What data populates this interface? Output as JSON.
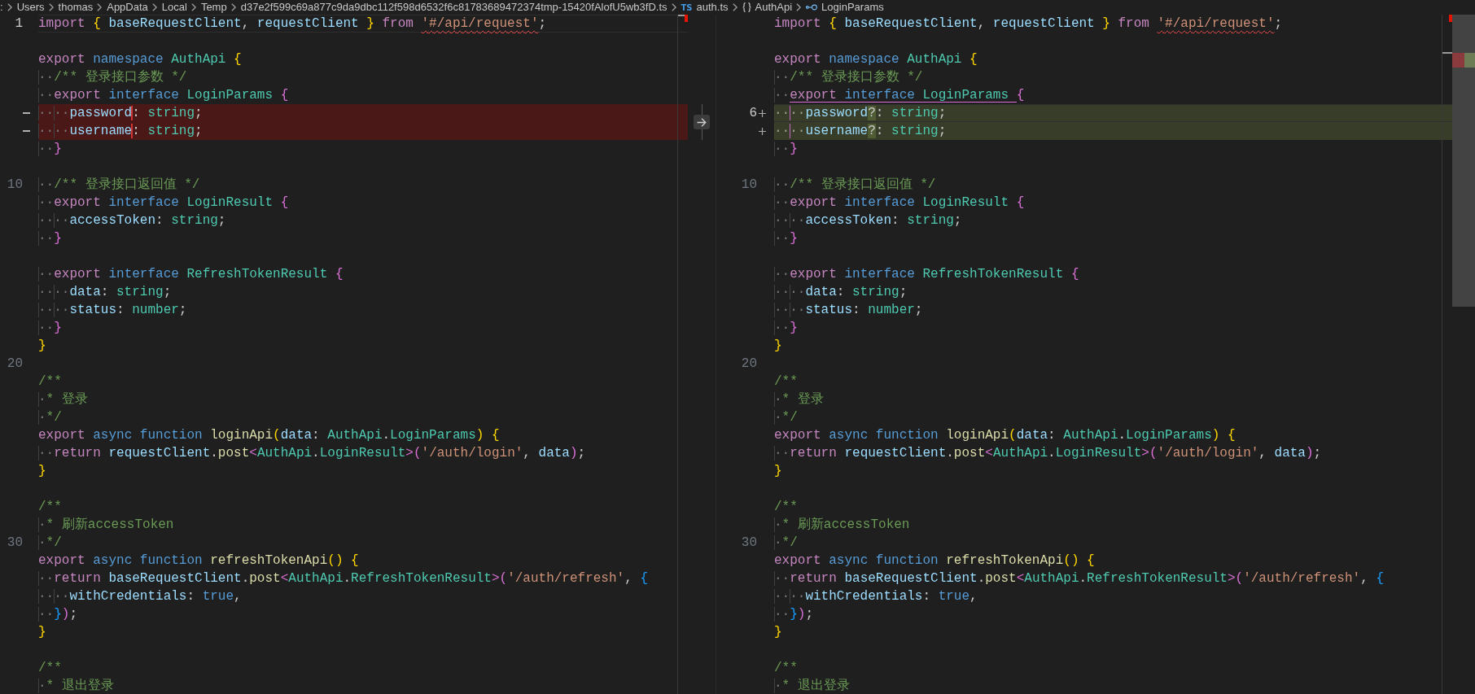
{
  "breadcrumbs": [
    {
      "label": ":",
      "kind": "folder"
    },
    {
      "label": "Users",
      "kind": "folder"
    },
    {
      "label": "thomas",
      "kind": "folder"
    },
    {
      "label": "AppData",
      "kind": "folder"
    },
    {
      "label": "Local",
      "kind": "folder"
    },
    {
      "label": "Temp",
      "kind": "folder"
    },
    {
      "label": "d37e2f599c69a877c9da9dbc112f598d6532f6c81783689472374tmp-15420fAlofU5wb3fD.ts",
      "kind": "folder"
    },
    {
      "label": "auth.ts",
      "kind": "file",
      "badge": "TS"
    },
    {
      "label": "AuthApi",
      "kind": "namespace"
    },
    {
      "label": "LoginParams",
      "kind": "interface"
    }
  ],
  "panes": [
    {
      "lines": [
        {
          "kind": "current",
          "number": "1",
          "tokens": [
            {
              "text": "import ",
              "kind": "keyword"
            },
            {
              "text": "{ ",
              "kind": "bracket1"
            },
            {
              "text": "baseRequestClient",
              "kind": "variable"
            },
            {
              "text": ", ",
              "kind": "plain"
            },
            {
              "text": "requestClient ",
              "kind": "variable"
            },
            {
              "text": "} ",
              "kind": "bracket1"
            },
            {
              "text": "from ",
              "kind": "keyword"
            },
            {
              "text": "'#/api/request'",
              "kind": "squiggle"
            },
            {
              "text": ";",
              "kind": "plain"
            }
          ]
        },
        {
          "kind": "context"
        },
        {
          "kind": "context",
          "tokens": [
            {
              "text": "export ",
              "kind": "keyword"
            },
            {
              "text": "namespace ",
              "kind": "storage"
            },
            {
              "text": "AuthApi ",
              "kind": "type"
            },
            {
              "text": "{",
              "kind": "bracket1"
            }
          ]
        },
        {
          "kind": "context",
          "tokens": [
            {
              "text": "··",
              "kind": "space"
            },
            {
              "text": "/** 登录接口参数 */",
              "kind": "comment"
            }
          ]
        },
        {
          "kind": "context",
          "tokens": [
            {
              "text": "··",
              "kind": "space"
            },
            {
              "text": "export ",
              "kind": "keyword"
            },
            {
              "text": "interface ",
              "kind": "storage"
            },
            {
              "text": "LoginParams ",
              "kind": "type"
            },
            {
              "text": "{",
              "kind": "bracket2"
            }
          ]
        },
        {
          "kind": "removed",
          "tokens": [
            {
              "text": "····",
              "kind": "space"
            },
            {
              "text": "password",
              "kind": "variable"
            },
            {
              "text": ": ",
              "kind": "cut"
            },
            {
              "text": "string",
              "kind": "type"
            },
            {
              "text": ";",
              "kind": "plain"
            }
          ]
        },
        {
          "kind": "removed",
          "tokens": [
            {
              "text": "····",
              "kind": "space"
            },
            {
              "text": "username",
              "kind": "variable"
            },
            {
              "text": ": ",
              "kind": "cut"
            },
            {
              "text": "string",
              "kind": "type"
            },
            {
              "text": ";",
              "kind": "plain"
            }
          ]
        },
        {
          "kind": "context",
          "tokens": [
            {
              "text": "··",
              "kind": "space"
            },
            {
              "text": "}",
              "kind": "bracket2"
            }
          ]
        },
        {
          "kind": "context"
        },
        {
          "kind": "context",
          "number": "10",
          "tokens": [
            {
              "text": "··",
              "kind": "space"
            },
            {
              "text": "/** 登录接口返回值 */",
              "kind": "comment"
            }
          ]
        },
        {
          "kind": "context",
          "tokens": [
            {
              "text": "··",
              "kind": "space"
            },
            {
              "text": "export ",
              "kind": "keyword"
            },
            {
              "text": "interface ",
              "kind": "storage"
            },
            {
              "text": "LoginResult ",
              "kind": "type"
            },
            {
              "text": "{",
              "kind": "bracket2"
            }
          ]
        },
        {
          "kind": "context",
          "tokens": [
            {
              "text": "····",
              "kind": "space"
            },
            {
              "text": "accessToken",
              "kind": "variable"
            },
            {
              "text": ": ",
              "kind": "plain"
            },
            {
              "text": "string",
              "kind": "type"
            },
            {
              "text": ";",
              "kind": "plain"
            }
          ]
        },
        {
          "kind": "context",
          "tokens": [
            {
              "text": "··",
              "kind": "space"
            },
            {
              "text": "}",
              "kind": "bracket2"
            }
          ]
        },
        {
          "kind": "context"
        },
        {
          "kind": "context",
          "tokens": [
            {
              "text": "··",
              "kind": "space"
            },
            {
              "text": "export ",
              "kind": "keyword"
            },
            {
              "text": "interface ",
              "kind": "storage"
            },
            {
              "text": "RefreshTokenResult ",
              "kind": "type"
            },
            {
              "text": "{",
              "kind": "bracket2"
            }
          ]
        },
        {
          "kind": "context",
          "tokens": [
            {
              "text": "····",
              "kind": "space"
            },
            {
              "text": "data",
              "kind": "variable"
            },
            {
              "text": ": ",
              "kind": "plain"
            },
            {
              "text": "string",
              "kind": "type"
            },
            {
              "text": ";",
              "kind": "plain"
            }
          ]
        },
        {
          "kind": "context",
          "tokens": [
            {
              "text": "····",
              "kind": "space"
            },
            {
              "text": "status",
              "kind": "variable"
            },
            {
              "text": ": ",
              "kind": "plain"
            },
            {
              "text": "number",
              "kind": "type"
            },
            {
              "text": ";",
              "kind": "plain"
            }
          ]
        },
        {
          "kind": "context",
          "tokens": [
            {
              "text": "··",
              "kind": "space"
            },
            {
              "text": "}",
              "kind": "bracket2"
            }
          ]
        },
        {
          "kind": "context",
          "tokens": [
            {
              "text": "}",
              "kind": "bracket1"
            }
          ]
        },
        {
          "kind": "context",
          "number": "20"
        },
        {
          "kind": "context",
          "tokens": [
            {
              "text": "/**",
              "kind": "comment"
            }
          ]
        },
        {
          "kind": "context",
          "tokens": [
            {
              "text": "·",
              "kind": "space"
            },
            {
              "text": "* 登录",
              "kind": "comment"
            }
          ]
        },
        {
          "kind": "context",
          "tokens": [
            {
              "text": "·",
              "kind": "space"
            },
            {
              "text": "*/",
              "kind": "comment"
            }
          ]
        },
        {
          "kind": "context",
          "tokens": [
            {
              "text": "export ",
              "kind": "keyword"
            },
            {
              "text": "async ",
              "kind": "storage"
            },
            {
              "text": "function ",
              "kind": "storage"
            },
            {
              "text": "loginApi",
              "kind": "function"
            },
            {
              "text": "(",
              "kind": "bracket1"
            },
            {
              "text": "data",
              "kind": "variable"
            },
            {
              "text": ": ",
              "kind": "plain"
            },
            {
              "text": "AuthApi",
              "kind": "type"
            },
            {
              "text": ".",
              "kind": "plain"
            },
            {
              "text": "LoginParams",
              "kind": "type"
            },
            {
              "text": ") {",
              "kind": "bracket1"
            }
          ]
        },
        {
          "kind": "context",
          "tokens": [
            {
              "text": "··",
              "kind": "space"
            },
            {
              "text": "return ",
              "kind": "keyword"
            },
            {
              "text": "requestClient",
              "kind": "variable"
            },
            {
              "text": ".",
              "kind": "plain"
            },
            {
              "text": "post",
              "kind": "function"
            },
            {
              "text": "<",
              "kind": "bracket2"
            },
            {
              "text": "AuthApi",
              "kind": "type"
            },
            {
              "text": ".",
              "kind": "plain"
            },
            {
              "text": "LoginResult",
              "kind": "type"
            },
            {
              "text": ">(",
              "kind": "bracket2"
            },
            {
              "text": "'/auth/login'",
              "kind": "string"
            },
            {
              "text": ", ",
              "kind": "plain"
            },
            {
              "text": "data",
              "kind": "variable"
            },
            {
              "text": ")",
              "kind": "bracket2"
            },
            {
              "text": ";",
              "kind": "plain"
            }
          ]
        },
        {
          "kind": "context",
          "tokens": [
            {
              "text": "}",
              "kind": "bracket1"
            }
          ]
        },
        {
          "kind": "context"
        },
        {
          "kind": "context",
          "tokens": [
            {
              "text": "/**",
              "kind": "comment"
            }
          ]
        },
        {
          "kind": "context",
          "tokens": [
            {
              "text": "·",
              "kind": "space"
            },
            {
              "text": "* 刷新accessToken",
              "kind": "comment"
            }
          ]
        },
        {
          "kind": "context",
          "number": "30",
          "tokens": [
            {
              "text": "·",
              "kind": "space"
            },
            {
              "text": "*/",
              "kind": "comment"
            }
          ]
        },
        {
          "kind": "context",
          "tokens": [
            {
              "text": "export ",
              "kind": "keyword"
            },
            {
              "text": "async ",
              "kind": "storage"
            },
            {
              "text": "function ",
              "kind": "storage"
            },
            {
              "text": "refreshTokenApi",
              "kind": "function"
            },
            {
              "text": "() {",
              "kind": "bracket1"
            }
          ]
        },
        {
          "kind": "context",
          "tokens": [
            {
              "text": "··",
              "kind": "space"
            },
            {
              "text": "return ",
              "kind": "keyword"
            },
            {
              "text": "baseRequestClient",
              "kind": "variable"
            },
            {
              "text": ".",
              "kind": "plain"
            },
            {
              "text": "post",
              "kind": "function"
            },
            {
              "text": "<",
              "kind": "bracket2"
            },
            {
              "text": "AuthApi",
              "kind": "type"
            },
            {
              "text": ".",
              "kind": "plain"
            },
            {
              "text": "RefreshTokenResult",
              "kind": "type"
            },
            {
              "text": ">(",
              "kind": "bracket2"
            },
            {
              "text": "'/auth/refresh'",
              "kind": "string"
            },
            {
              "text": ", ",
              "kind": "plain"
            },
            {
              "text": "{",
              "kind": "bracket3"
            }
          ]
        },
        {
          "kind": "context",
          "tokens": [
            {
              "text": "····",
              "kind": "space"
            },
            {
              "text": "withCredentials",
              "kind": "variable"
            },
            {
              "text": ": ",
              "kind": "plain"
            },
            {
              "text": "true",
              "kind": "storage"
            },
            {
              "text": ",",
              "kind": "plain"
            }
          ]
        },
        {
          "kind": "context",
          "tokens": [
            {
              "text": "··",
              "kind": "space"
            },
            {
              "text": "}",
              "kind": "bracket3"
            },
            {
              "text": ")",
              "kind": "bracket2"
            },
            {
              "text": ";",
              "kind": "plain"
            }
          ]
        },
        {
          "kind": "context",
          "tokens": [
            {
              "text": "}",
              "kind": "bracket1"
            }
          ]
        },
        {
          "kind": "context"
        },
        {
          "kind": "context",
          "tokens": [
            {
              "text": "/**",
              "kind": "comment"
            }
          ]
        },
        {
          "kind": "context",
          "tokens": [
            {
              "text": "·",
              "kind": "space"
            },
            {
              "text": "* 退出登录",
              "kind": "comment"
            }
          ]
        }
      ]
    },
    {
      "lines": [
        {
          "kind": "context",
          "tokens": [
            {
              "text": "import ",
              "kind": "keyword"
            },
            {
              "text": "{ ",
              "kind": "bracket1"
            },
            {
              "text": "baseRequestClient",
              "kind": "variable"
            },
            {
              "text": ", ",
              "kind": "plain"
            },
            {
              "text": "requestClient ",
              "kind": "variable"
            },
            {
              "text": "} ",
              "kind": "bracket1"
            },
            {
              "text": "from ",
              "kind": "keyword"
            },
            {
              "text": "'#/api/request'",
              "kind": "squiggle"
            },
            {
              "text": ";",
              "kind": "plain"
            }
          ]
        },
        {
          "kind": "context"
        },
        {
          "kind": "context",
          "tokens": [
            {
              "text": "export ",
              "kind": "keyword"
            },
            {
              "text": "namespace ",
              "kind": "storage"
            },
            {
              "text": "AuthApi ",
              "kind": "type"
            },
            {
              "text": "{",
              "kind": "bracket1"
            }
          ]
        },
        {
          "kind": "context",
          "tokens": [
            {
              "text": "··",
              "kind": "space"
            },
            {
              "text": "/** 登录接口参数 */",
              "kind": "comment"
            }
          ]
        },
        {
          "kind": "bracket-open",
          "tokens": [
            {
              "text": "··",
              "kind": "space"
            },
            {
              "text": "export ",
              "kind": "keyword"
            },
            {
              "text": "interface ",
              "kind": "storage"
            },
            {
              "text": "LoginParams ",
              "kind": "type"
            },
            {
              "text": "{",
              "kind": "bracket2"
            }
          ]
        },
        {
          "kind": "added-current",
          "number": "6",
          "tokens": [
            {
              "text": "····",
              "kind": "space-guide"
            },
            {
              "text": "password",
              "kind": "variable"
            },
            {
              "text": "?",
              "kind": "inserted"
            },
            {
              "text": ": ",
              "kind": "plain"
            },
            {
              "text": "string",
              "kind": "type"
            },
            {
              "text": ";",
              "kind": "plain"
            }
          ]
        },
        {
          "kind": "added",
          "tokens": [
            {
              "text": "····",
              "kind": "space-guide"
            },
            {
              "text": "username",
              "kind": "variable"
            },
            {
              "text": "?",
              "kind": "inserted"
            },
            {
              "text": ": ",
              "kind": "plain"
            },
            {
              "text": "string",
              "kind": "type"
            },
            {
              "text": ";",
              "kind": "plain"
            }
          ]
        },
        {
          "kind": "context",
          "tokens": [
            {
              "text": "··",
              "kind": "space"
            },
            {
              "text": "}",
              "kind": "bracket2"
            }
          ]
        },
        {
          "kind": "context"
        },
        {
          "kind": "context",
          "number": "10",
          "tokens": [
            {
              "text": "··",
              "kind": "space"
            },
            {
              "text": "/** 登录接口返回值 */",
              "kind": "comment"
            }
          ]
        },
        {
          "kind": "context",
          "tokens": [
            {
              "text": "··",
              "kind": "space"
            },
            {
              "text": "export ",
              "kind": "keyword"
            },
            {
              "text": "interface ",
              "kind": "storage"
            },
            {
              "text": "LoginResult ",
              "kind": "type"
            },
            {
              "text": "{",
              "kind": "bracket2"
            }
          ]
        },
        {
          "kind": "context",
          "tokens": [
            {
              "text": "····",
              "kind": "space"
            },
            {
              "text": "accessToken",
              "kind": "variable"
            },
            {
              "text": ": ",
              "kind": "plain"
            },
            {
              "text": "string",
              "kind": "type"
            },
            {
              "text": ";",
              "kind": "plain"
            }
          ]
        },
        {
          "kind": "context",
          "tokens": [
            {
              "text": "··",
              "kind": "space"
            },
            {
              "text": "}",
              "kind": "bracket2"
            }
          ]
        },
        {
          "kind": "context"
        },
        {
          "kind": "context",
          "tokens": [
            {
              "text": "··",
              "kind": "space"
            },
            {
              "text": "export ",
              "kind": "keyword"
            },
            {
              "text": "interface ",
              "kind": "storage"
            },
            {
              "text": "RefreshTokenResult ",
              "kind": "type"
            },
            {
              "text": "{",
              "kind": "bracket2"
            }
          ]
        },
        {
          "kind": "context",
          "tokens": [
            {
              "text": "····",
              "kind": "space"
            },
            {
              "text": "data",
              "kind": "variable"
            },
            {
              "text": ": ",
              "kind": "plain"
            },
            {
              "text": "string",
              "kind": "type"
            },
            {
              "text": ";",
              "kind": "plain"
            }
          ]
        },
        {
          "kind": "context",
          "tokens": [
            {
              "text": "····",
              "kind": "space"
            },
            {
              "text": "status",
              "kind": "variable"
            },
            {
              "text": ": ",
              "kind": "plain"
            },
            {
              "text": "number",
              "kind": "type"
            },
            {
              "text": ";",
              "kind": "plain"
            }
          ]
        },
        {
          "kind": "context",
          "tokens": [
            {
              "text": "··",
              "kind": "space"
            },
            {
              "text": "}",
              "kind": "bracket2"
            }
          ]
        },
        {
          "kind": "context",
          "tokens": [
            {
              "text": "}",
              "kind": "bracket1"
            }
          ]
        },
        {
          "kind": "context",
          "number": "20"
        },
        {
          "kind": "context",
          "tokens": [
            {
              "text": "/**",
              "kind": "comment"
            }
          ]
        },
        {
          "kind": "context",
          "tokens": [
            {
              "text": "·",
              "kind": "space"
            },
            {
              "text": "* 登录",
              "kind": "comment"
            }
          ]
        },
        {
          "kind": "context",
          "tokens": [
            {
              "text": "·",
              "kind": "space"
            },
            {
              "text": "*/",
              "kind": "comment"
            }
          ]
        },
        {
          "kind": "context",
          "tokens": [
            {
              "text": "export ",
              "kind": "keyword"
            },
            {
              "text": "async ",
              "kind": "storage"
            },
            {
              "text": "function ",
              "kind": "storage"
            },
            {
              "text": "loginApi",
              "kind": "function"
            },
            {
              "text": "(",
              "kind": "bracket1"
            },
            {
              "text": "data",
              "kind": "variable"
            },
            {
              "text": ": ",
              "kind": "plain"
            },
            {
              "text": "AuthApi",
              "kind": "type"
            },
            {
              "text": ".",
              "kind": "plain"
            },
            {
              "text": "LoginParams",
              "kind": "type"
            },
            {
              "text": ") {",
              "kind": "bracket1"
            }
          ]
        },
        {
          "kind": "context",
          "tokens": [
            {
              "text": "··",
              "kind": "space"
            },
            {
              "text": "return ",
              "kind": "keyword"
            },
            {
              "text": "requestClient",
              "kind": "variable"
            },
            {
              "text": ".",
              "kind": "plain"
            },
            {
              "text": "post",
              "kind": "function"
            },
            {
              "text": "<",
              "kind": "bracket2"
            },
            {
              "text": "AuthApi",
              "kind": "type"
            },
            {
              "text": ".",
              "kind": "plain"
            },
            {
              "text": "LoginResult",
              "kind": "type"
            },
            {
              "text": ">(",
              "kind": "bracket2"
            },
            {
              "text": "'/auth/login'",
              "kind": "string"
            },
            {
              "text": ", ",
              "kind": "plain"
            },
            {
              "text": "data",
              "kind": "variable"
            },
            {
              "text": ")",
              "kind": "bracket2"
            },
            {
              "text": ";",
              "kind": "plain"
            }
          ]
        },
        {
          "kind": "context",
          "tokens": [
            {
              "text": "}",
              "kind": "bracket1"
            }
          ]
        },
        {
          "kind": "context"
        },
        {
          "kind": "context",
          "tokens": [
            {
              "text": "/**",
              "kind": "comment"
            }
          ]
        },
        {
          "kind": "context",
          "tokens": [
            {
              "text": "·",
              "kind": "space"
            },
            {
              "text": "* 刷新accessToken",
              "kind": "comment"
            }
          ]
        },
        {
          "kind": "context",
          "number": "30",
          "tokens": [
            {
              "text": "·",
              "kind": "space"
            },
            {
              "text": "*/",
              "kind": "comment"
            }
          ]
        },
        {
          "kind": "context",
          "tokens": [
            {
              "text": "export ",
              "kind": "keyword"
            },
            {
              "text": "async ",
              "kind": "storage"
            },
            {
              "text": "function ",
              "kind": "storage"
            },
            {
              "text": "refreshTokenApi",
              "kind": "function"
            },
            {
              "text": "() {",
              "kind": "bracket1"
            }
          ]
        },
        {
          "kind": "context",
          "tokens": [
            {
              "text": "··",
              "kind": "space"
            },
            {
              "text": "return ",
              "kind": "keyword"
            },
            {
              "text": "baseRequestClient",
              "kind": "variable"
            },
            {
              "text": ".",
              "kind": "plain"
            },
            {
              "text": "post",
              "kind": "function"
            },
            {
              "text": "<",
              "kind": "bracket2"
            },
            {
              "text": "AuthApi",
              "kind": "type"
            },
            {
              "text": ".",
              "kind": "plain"
            },
            {
              "text": "RefreshTokenResult",
              "kind": "type"
            },
            {
              "text": ">(",
              "kind": "bracket2"
            },
            {
              "text": "'/auth/refresh'",
              "kind": "string"
            },
            {
              "text": ", ",
              "kind": "plain"
            },
            {
              "text": "{",
              "kind": "bracket3"
            }
          ]
        },
        {
          "kind": "context",
          "tokens": [
            {
              "text": "····",
              "kind": "space"
            },
            {
              "text": "withCredentials",
              "kind": "variable"
            },
            {
              "text": ": ",
              "kind": "plain"
            },
            {
              "text": "true",
              "kind": "storage"
            },
            {
              "text": ",",
              "kind": "plain"
            }
          ]
        },
        {
          "kind": "context",
          "tokens": [
            {
              "text": "··",
              "kind": "space"
            },
            {
              "text": "}",
              "kind": "bracket3"
            },
            {
              "text": ")",
              "kind": "bracket2"
            },
            {
              "text": ";",
              "kind": "plain"
            }
          ]
        },
        {
          "kind": "context",
          "tokens": [
            {
              "text": "}",
              "kind": "bracket1"
            }
          ]
        },
        {
          "kind": "context"
        },
        {
          "kind": "context",
          "tokens": [
            {
              "text": "/**",
              "kind": "comment"
            }
          ]
        },
        {
          "kind": "context",
          "tokens": [
            {
              "text": "·",
              "kind": "space"
            },
            {
              "text": "* 退出登录",
              "kind": "comment"
            }
          ]
        }
      ]
    }
  ]
}
